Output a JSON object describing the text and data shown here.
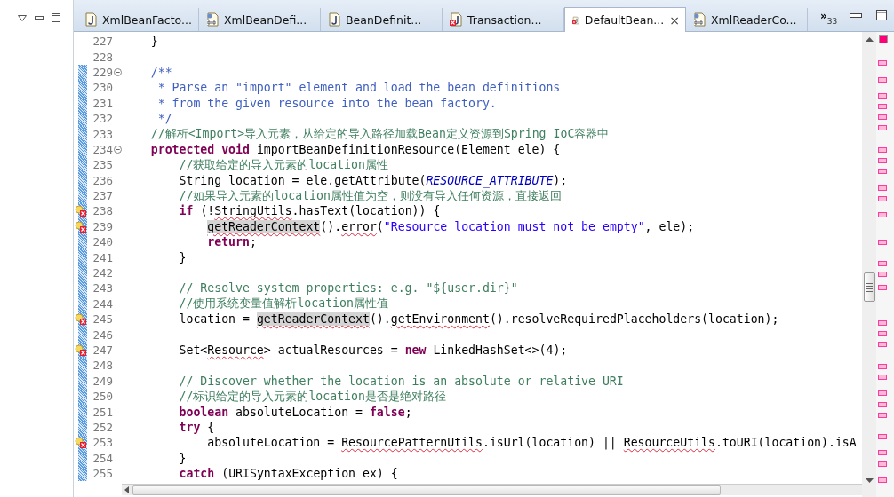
{
  "tabs": [
    {
      "label": "XmlBeanFacto...",
      "kind": "java",
      "error": false,
      "selected": false
    },
    {
      "label": "XmlBeanDefi...",
      "kind": "class",
      "error": false,
      "selected": false
    },
    {
      "label": "BeanDefinit...",
      "kind": "java",
      "error": false,
      "selected": false
    },
    {
      "label": "Transaction...",
      "kind": "java",
      "error": true,
      "selected": false
    },
    {
      "label": "DefaultBean...",
      "kind": "java",
      "error": true,
      "selected": true,
      "close": "×"
    },
    {
      "label": "XmlReaderCo...",
      "kind": "class",
      "error": false,
      "selected": false
    }
  ],
  "overflow": {
    "label": "»",
    "count": "33"
  },
  "lines": [
    {
      "number": "227",
      "changed": false,
      "error": false,
      "foldable": false,
      "segments": [
        {
          "kind": "plain",
          "text": "    }"
        }
      ]
    },
    {
      "number": "228",
      "changed": false,
      "error": false,
      "foldable": false
    },
    {
      "number": "229",
      "changed": true,
      "error": false,
      "foldable": true,
      "segments": [
        {
          "kind": "javadoc",
          "text": "    /**"
        }
      ]
    },
    {
      "number": "230",
      "changed": true,
      "error": false,
      "foldable": false,
      "segments": [
        {
          "kind": "javadoc",
          "text": "     * Parse an \"import\" element and load the bean definitions"
        }
      ]
    },
    {
      "number": "231",
      "changed": true,
      "error": false,
      "foldable": false,
      "segments": [
        {
          "kind": "javadoc",
          "text": "     * from the given resource into the bean factory."
        }
      ]
    },
    {
      "number": "232",
      "changed": true,
      "error": false,
      "foldable": false,
      "segments": [
        {
          "kind": "javadoc",
          "text": "     */"
        }
      ]
    },
    {
      "number": "233",
      "changed": true,
      "error": false,
      "foldable": false,
      "segments": [
        {
          "kind": "comment",
          "text": "    //解析<Import>导入元素，从给定的导入路径加载Bean定义资源到Spring IoC容器中"
        }
      ]
    },
    {
      "number": "234",
      "changed": true,
      "error": false,
      "foldable": true,
      "segments": [
        {
          "kind": "keyword",
          "text": "    protected void"
        },
        {
          "kind": "plain",
          "text": " importBeanDefinitionResource(Element ele) {"
        }
      ]
    },
    {
      "number": "235",
      "changed": true,
      "error": false,
      "foldable": false,
      "segments": [
        {
          "kind": "comment",
          "text": "        //获取给定的导入元素的location属性"
        }
      ]
    },
    {
      "number": "236",
      "changed": true,
      "error": false,
      "foldable": false,
      "segments": [
        {
          "kind": "plain",
          "text": "        String location = ele.getAttribute("
        },
        {
          "kind": "constant",
          "text": "RESOURCE_ATTRIBUTE"
        },
        {
          "kind": "plain",
          "text": ");"
        }
      ]
    },
    {
      "number": "237",
      "changed": true,
      "error": false,
      "foldable": false,
      "segments": [
        {
          "kind": "comment",
          "text": "        //如果导入元素的location属性值为空，则没有导入任何资源，直接返回"
        }
      ]
    },
    {
      "number": "238",
      "changed": true,
      "error": true,
      "foldable": false,
      "segments": [
        {
          "kind": "keyword",
          "text": "        if"
        },
        {
          "kind": "plain",
          "text": " (!"
        },
        {
          "kind": "plain",
          "text": "StringUtils",
          "squiggle": true
        },
        {
          "kind": "plain",
          "text": ".hasText(location)) {"
        }
      ]
    },
    {
      "number": "239",
      "changed": true,
      "error": true,
      "foldable": false,
      "segments": [
        {
          "kind": "plain",
          "text": "            getReaderContext",
          "squiggle": true,
          "highlight": true
        },
        {
          "kind": "plain",
          "text": "()."
        },
        {
          "kind": "plain",
          "text": "error",
          "squiggle": true
        },
        {
          "kind": "plain",
          "text": "("
        },
        {
          "kind": "string",
          "text": "\"Resource location must not be empty\""
        },
        {
          "kind": "plain",
          "text": ", ele);"
        }
      ]
    },
    {
      "number": "240",
      "changed": true,
      "error": false,
      "foldable": false,
      "segments": [
        {
          "kind": "keyword",
          "text": "            return"
        },
        {
          "kind": "plain",
          "text": ";"
        }
      ]
    },
    {
      "number": "241",
      "changed": true,
      "error": false,
      "foldable": false,
      "segments": [
        {
          "kind": "plain",
          "text": "        }"
        }
      ]
    },
    {
      "number": "242",
      "changed": true,
      "error": false,
      "foldable": false
    },
    {
      "number": "243",
      "changed": true,
      "error": false,
      "foldable": false,
      "segments": [
        {
          "kind": "comment",
          "text": "        // Resolve system properties: e.g. \"${user.dir}\""
        }
      ]
    },
    {
      "number": "244",
      "changed": true,
      "error": false,
      "foldable": false,
      "segments": [
        {
          "kind": "comment",
          "text": "        //使用系统变量值解析location属性值"
        }
      ]
    },
    {
      "number": "245",
      "changed": true,
      "error": true,
      "foldable": false,
      "segments": [
        {
          "kind": "plain",
          "text": "        location = "
        },
        {
          "kind": "plain",
          "text": "getReaderContext",
          "squiggle": true,
          "highlight": true
        },
        {
          "kind": "plain",
          "text": "()."
        },
        {
          "kind": "plain",
          "text": "getEnvironment",
          "squiggle": true
        },
        {
          "kind": "plain",
          "text": "().resolveRequiredPlaceholders(location);"
        }
      ]
    },
    {
      "number": "246",
      "changed": true,
      "error": false,
      "foldable": false
    },
    {
      "number": "247",
      "changed": true,
      "error": true,
      "foldable": false,
      "segments": [
        {
          "kind": "plain",
          "text": "        Set<"
        },
        {
          "kind": "plain",
          "text": "Resource",
          "squiggle": true
        },
        {
          "kind": "plain",
          "text": "> actualResources = "
        },
        {
          "kind": "keyword",
          "text": "new"
        },
        {
          "kind": "plain",
          "text": " LinkedHashSet<>(4);"
        }
      ]
    },
    {
      "number": "248",
      "changed": true,
      "error": false,
      "foldable": false
    },
    {
      "number": "249",
      "changed": true,
      "error": false,
      "foldable": false,
      "segments": [
        {
          "kind": "comment",
          "text": "        // Discover whether the location is an absolute or relative URI"
        }
      ]
    },
    {
      "number": "250",
      "changed": true,
      "error": false,
      "foldable": false,
      "segments": [
        {
          "kind": "comment",
          "text": "        //标识给定的导入元素的location是否是绝对路径"
        }
      ]
    },
    {
      "number": "251",
      "changed": true,
      "error": false,
      "foldable": false,
      "segments": [
        {
          "kind": "keyword",
          "text": "        boolean"
        },
        {
          "kind": "plain",
          "text": " absoluteLocation = "
        },
        {
          "kind": "keyword",
          "text": "false"
        },
        {
          "kind": "plain",
          "text": ";"
        }
      ]
    },
    {
      "number": "252",
      "changed": true,
      "error": false,
      "foldable": false,
      "segments": [
        {
          "kind": "keyword",
          "text": "        try"
        },
        {
          "kind": "plain",
          "text": " {"
        }
      ]
    },
    {
      "number": "253",
      "changed": true,
      "error": true,
      "foldable": false,
      "segments": [
        {
          "kind": "plain",
          "text": "            absoluteLocation = "
        },
        {
          "kind": "plain",
          "text": "ResourcePatternUtils",
          "squiggle": true
        },
        {
          "kind": "plain",
          "text": ".isUrl(location) || "
        },
        {
          "kind": "plain",
          "text": "ResourceUtils",
          "squiggle": true
        },
        {
          "kind": "plain",
          "text": ".toURI(location).isA"
        }
      ]
    },
    {
      "number": "254",
      "changed": true,
      "error": false,
      "foldable": false,
      "segments": [
        {
          "kind": "plain",
          "text": "        }"
        }
      ]
    },
    {
      "number": "255",
      "changed": true,
      "error": false,
      "foldable": false,
      "segments": [
        {
          "kind": "keyword",
          "text": "        catch"
        },
        {
          "kind": "plain",
          "text": " (URISyntaxException ex) {"
        }
      ]
    }
  ]
}
